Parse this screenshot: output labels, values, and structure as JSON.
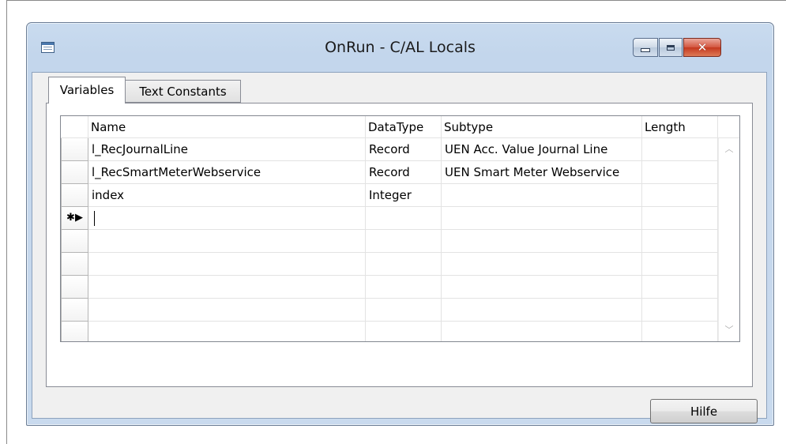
{
  "window": {
    "title": "OnRun - C/AL Locals",
    "close_glyph": "✕"
  },
  "tabs": [
    {
      "label": "Variables",
      "selected": true
    },
    {
      "label": "Text Constants",
      "selected": false
    }
  ],
  "grid": {
    "columns": [
      "Name",
      "DataType",
      "Subtype",
      "Length"
    ],
    "rows": [
      {
        "name": "l_RecJournalLine",
        "datatype": "Record",
        "subtype": "UEN Acc. Value Journal Line",
        "length": ""
      },
      {
        "name": "l_RecSmartMeterWebservice",
        "datatype": "Record",
        "subtype": "UEN Smart Meter Webservice",
        "length": ""
      },
      {
        "name": "index",
        "datatype": "Integer",
        "subtype": "",
        "length": ""
      },
      {
        "name": "",
        "datatype": "",
        "subtype": "",
        "length": ""
      },
      {
        "name": "",
        "datatype": "",
        "subtype": "",
        "length": ""
      },
      {
        "name": "",
        "datatype": "",
        "subtype": "",
        "length": ""
      },
      {
        "name": "",
        "datatype": "",
        "subtype": "",
        "length": ""
      },
      {
        "name": "",
        "datatype": "",
        "subtype": "",
        "length": ""
      },
      {
        "name": "",
        "datatype": "",
        "subtype": "",
        "length": ""
      }
    ],
    "new_row_marker": "✱▶",
    "scroll_up_glyph": "︿",
    "scroll_down_glyph": "﹀"
  },
  "buttons": {
    "help_label": "Hilfe"
  },
  "icons": {
    "app": "table-window-icon",
    "minimize": "minimize-icon",
    "maximize": "maximize-icon",
    "close": "close-icon"
  },
  "colors": {
    "title_bar": "#c9dbef",
    "close_button": "#c4381f",
    "client_bg": "#f0f0f0",
    "grid_line": "#e3e3e3"
  }
}
